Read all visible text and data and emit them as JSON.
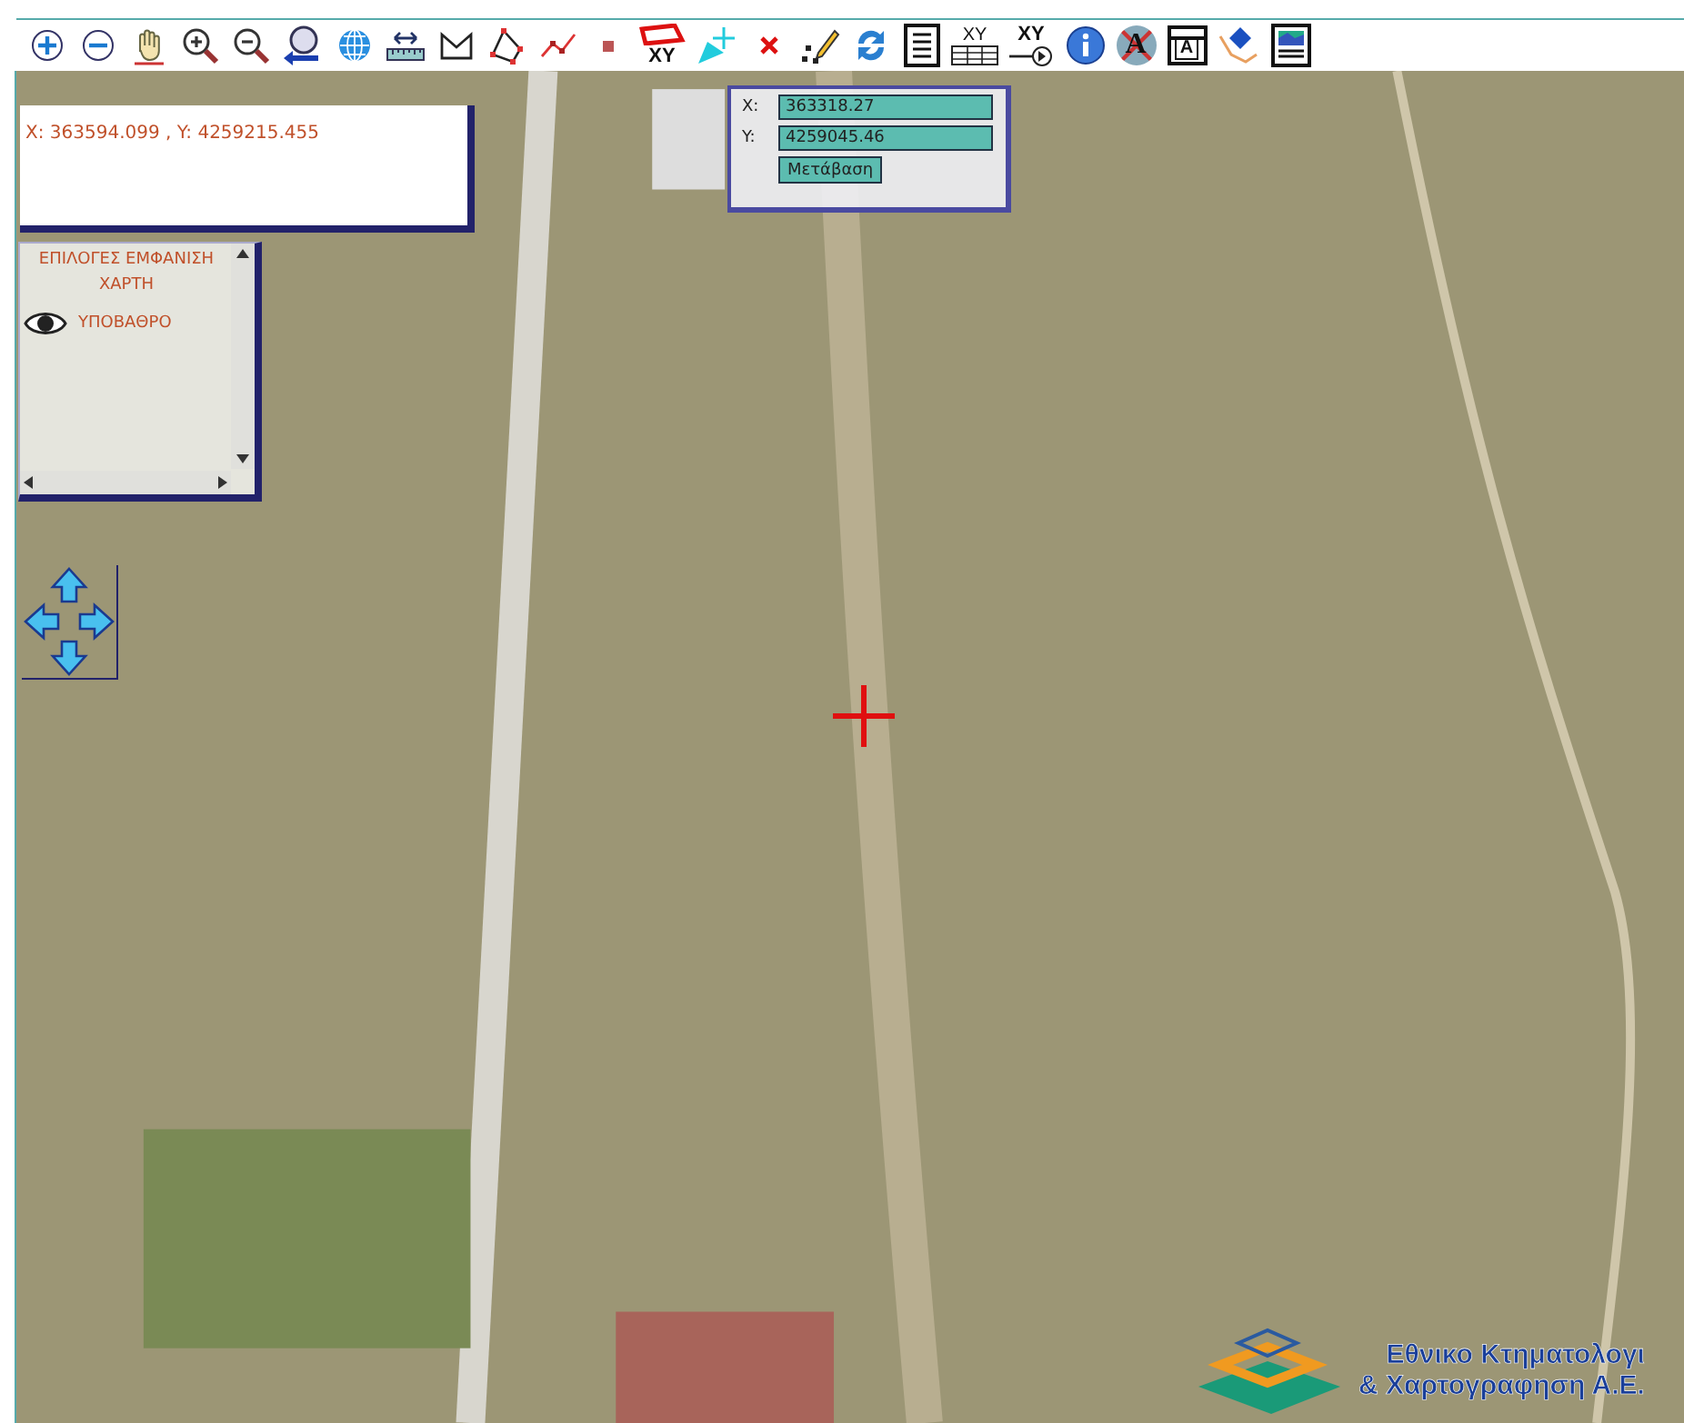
{
  "toolbar": [
    {
      "kind": "circle-plus"
    },
    {
      "kind": "circle-minus"
    },
    {
      "kind": "hand"
    },
    {
      "kind": "zoom-in"
    },
    {
      "kind": "zoom-out"
    },
    {
      "kind": "zoom-back"
    },
    {
      "kind": "globe"
    },
    {
      "kind": "ruler"
    },
    {
      "kind": "open-shape"
    },
    {
      "kind": "polygon"
    },
    {
      "kind": "polyline"
    },
    {
      "kind": "point"
    },
    {
      "kind": "polygon-xy",
      "label": "XY"
    },
    {
      "kind": "add-point"
    },
    {
      "kind": "delete"
    },
    {
      "kind": "pencil"
    },
    {
      "kind": "refresh"
    },
    {
      "kind": "document"
    },
    {
      "kind": "table-xy",
      "label": "XY"
    },
    {
      "kind": "xy-arrow",
      "label": "XY"
    },
    {
      "kind": "info"
    },
    {
      "kind": "crossed-a",
      "label": "A"
    },
    {
      "kind": "doc-a",
      "label": "A"
    },
    {
      "kind": "diamond"
    },
    {
      "kind": "image-doc"
    }
  ],
  "cursor_coordinates": "X: 363594.099 , Y: 4259215.455",
  "layers_panel": {
    "title_lines": [
      "ΕΠΙΛΟΓΕΣ ΕΜΦΑΝΙΣΗ",
      "ΧΑΡΤΗ"
    ],
    "layers": [
      {
        "label": "ΥΠΟΒΑΘΡΟ",
        "visible": true
      }
    ]
  },
  "goto_form": {
    "x_label": "X:",
    "x_value": "363318.27",
    "y_label": "Y:",
    "y_value": "4259045.46",
    "button": "Μετάβαση"
  },
  "logo": {
    "line_1": "Εθνικο Κτηματολογι",
    "line_2": "& Χαρτογραφηση Α.Ε."
  }
}
